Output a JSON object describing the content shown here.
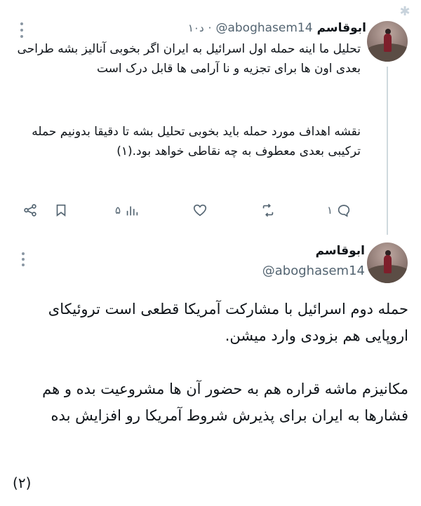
{
  "tweets": [
    {
      "display_name": "ابوقاسم",
      "handle": "@aboghasem14",
      "separator": "·",
      "time": "۱۰د",
      "paragraphs": [
        "تحلیل ما اینه حمله اول اسرائیل به ایران اگر بخوبی آنالیز بشه طراحی بعدی اون ها برای تجزیه و نا آرامی ها قابل درک است",
        "نقشه اهداف مورد حمله باید بخوبی تحلیل بشه تا دقیقا بدونیم حمله ترکیبی بعدی معطوف به چه نقاطی خواهد بود.(۱)"
      ],
      "actions": {
        "reply_count": "۱",
        "views_count": "۵",
        "icons": [
          "reply-icon",
          "retweet-icon",
          "like-icon",
          "views-icon",
          "bookmark-icon",
          "share-icon"
        ]
      }
    },
    {
      "display_name": "ابوقاسم",
      "handle": "@aboghasem14",
      "paragraphs": [
        "حمله دوم اسرائیل با مشارکت آمریکا قطعی است تروئیکای اروپایی هم بزودی وارد میشن.",
        "مکانیزم ماشه قراره هم به حضور آن ها مشروعیت بده و هم فشارها به ایران برای پذیرش شروط آمریکا رو افزایش بده"
      ],
      "footnote": "(۲)"
    }
  ]
}
